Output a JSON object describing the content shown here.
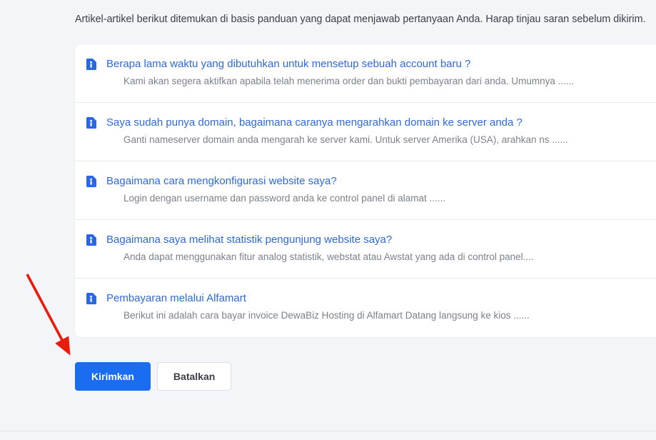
{
  "page": {
    "intro": "Artikel-artikel berikut ditemukan di basis panduan yang dapat menjawab pertanyaan Anda. Harap tinjau saran sebelum dikirim."
  },
  "articles": [
    {
      "icon": "document-info-icon",
      "title": "Berapa lama waktu yang dibutuhkan untuk mensetup sebuah account baru ?",
      "excerpt": "Kami akan segera aktifkan apabila telah menerima order dan bukti pembayaran dari anda. Umumnya ......"
    },
    {
      "icon": "document-info-icon",
      "title": "Saya sudah punya domain, bagaimana caranya mengarahkan domain ke server anda ?",
      "excerpt": "Ganti nameserver domain anda mengarah ke server kami. Untuk server Amerika (USA), arahkan ns ......"
    },
    {
      "icon": "document-info-icon",
      "title": "Bagaimana cara mengkonfigurasi website saya?",
      "excerpt": "Login dengan username dan password anda ke control panel di alamat ......"
    },
    {
      "icon": "document-info-icon",
      "title": "Bagaimana saya melihat statistik pengunjung website saya?",
      "excerpt": "Anda dapat menggunakan fitur analog statistik, webstat atau Awstat yang ada di control panel...."
    },
    {
      "icon": "document-info-icon",
      "title": "Pembayaran melalui Alfamart",
      "excerpt": "Berikut ini adalah cara bayar invoice DewaBiz Hosting di Alfamart Datang langsung ke kios ......"
    }
  ],
  "buttons": {
    "submit": "Kirimkan",
    "cancel": "Batalkan"
  },
  "colors": {
    "accent_blue": "#1a6cf0",
    "link_blue": "#2d69dc",
    "icon_blue": "#2a66e8",
    "excerpt_gray": "#7b818a",
    "background_gray": "#f4f5f8",
    "divider_gray": "#e8e9ec",
    "annotation_red": "#ea1b0c"
  }
}
